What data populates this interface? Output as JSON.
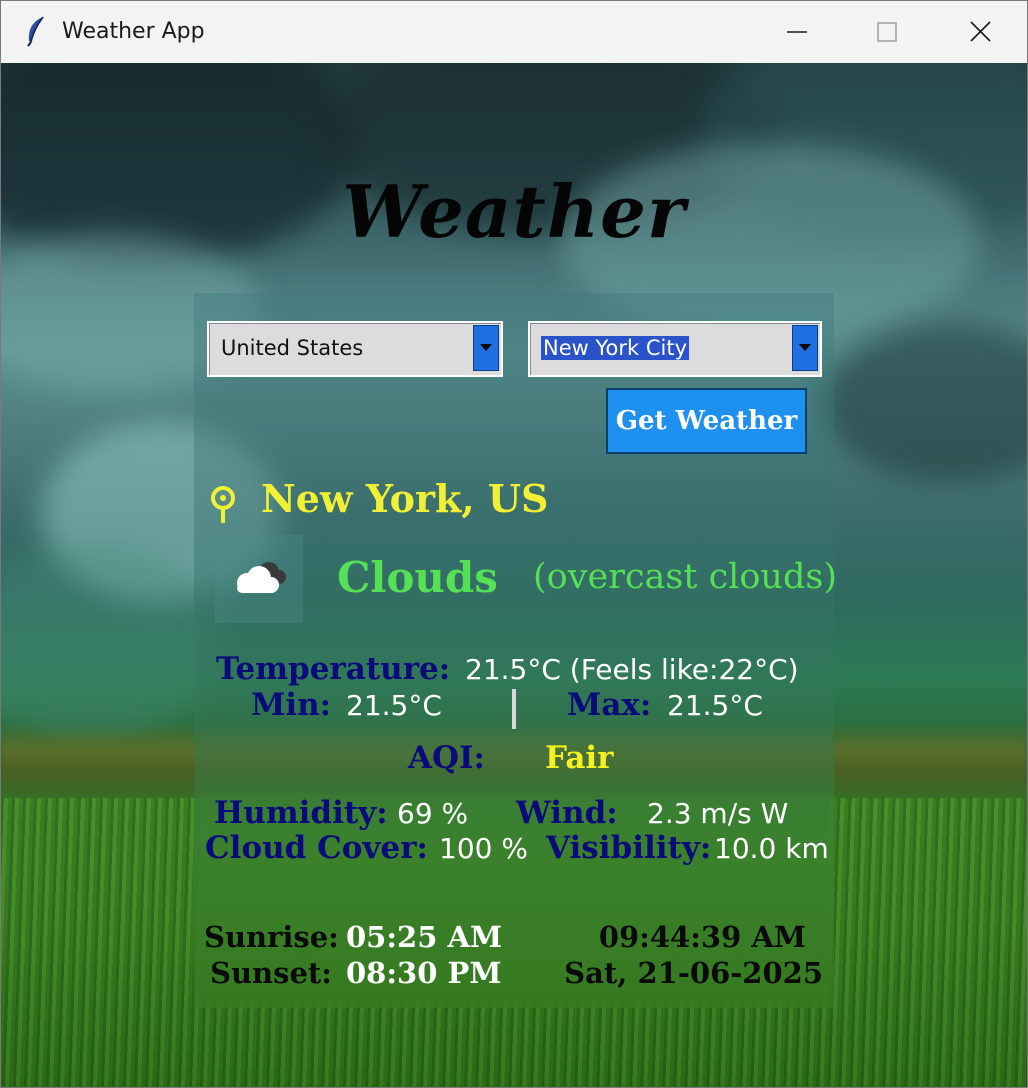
{
  "window": {
    "title": "Weather App",
    "icons": {
      "app": "feather-icon",
      "minimize": "minimize-icon",
      "maximize": "maximize-icon",
      "close": "close-icon"
    }
  },
  "header": {
    "title": "Weather"
  },
  "controls": {
    "country_value": "United States",
    "city_value": "New York City",
    "get_weather_label": "Get Weather"
  },
  "location": {
    "text": "New York, US",
    "icon": "location-pin-icon"
  },
  "condition": {
    "main": "Clouds",
    "description": "(overcast clouds)",
    "icon": "cloud-icon"
  },
  "metrics": {
    "temperature_label": "Temperature:",
    "temperature_value": "21.5°C (Feels like:22°C)",
    "min_label": "Min:",
    "min_value": "21.5°C",
    "max_label": "Max:",
    "max_value": "21.5°C",
    "aqi_label": "AQI:",
    "aqi_value": "Fair",
    "humidity_label": "Humidity:",
    "humidity_value": "69 %",
    "wind_label": "Wind:",
    "wind_value": "2.3 m/s W",
    "cloud_cover_label": "Cloud Cover:",
    "cloud_cover_value": "100 %",
    "visibility_label": "Visibility:",
    "visibility_value": "10.0 km"
  },
  "sun": {
    "sunrise_label": "Sunrise:",
    "sunrise_value": "05:25 AM",
    "sunset_label": "Sunset:",
    "sunset_value": "08:30 PM"
  },
  "clock": {
    "time": "09:44:39 AM",
    "date": "Sat, 21-06-2025"
  },
  "colors": {
    "accent_button": "#1e90f0",
    "combo_arrow": "#1e6fe0",
    "location_text": "#f2f035",
    "condition_text": "#55e055",
    "label_text": "#0a0a7a",
    "aqi_text": "#f5f020"
  }
}
